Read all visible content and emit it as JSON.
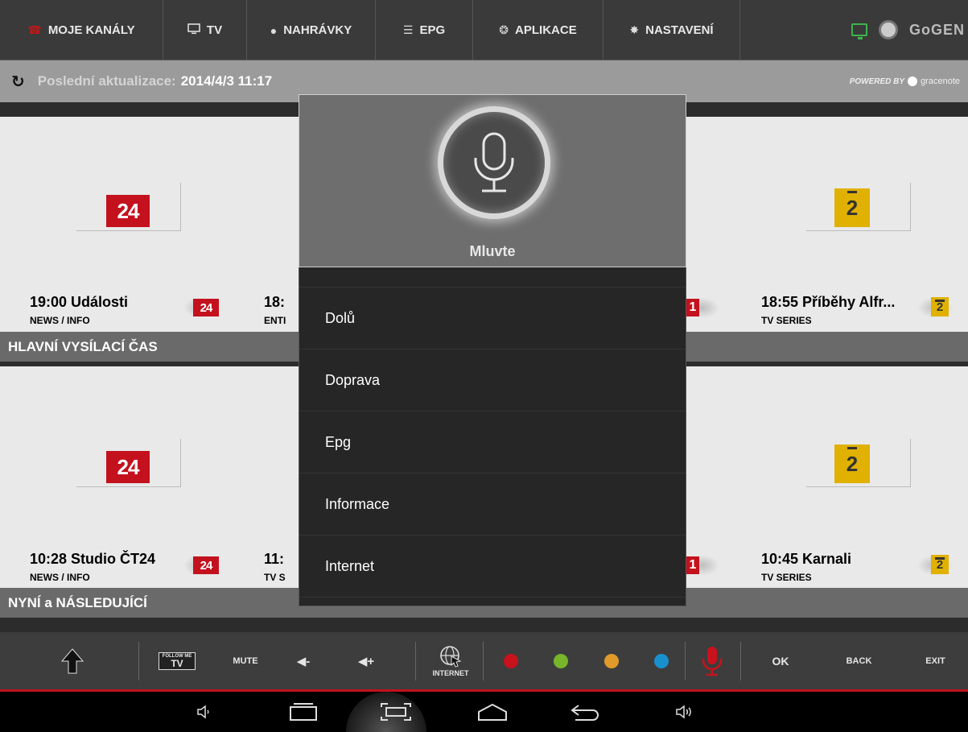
{
  "nav": {
    "items": [
      {
        "label": "MOJE KANÁLY",
        "icon": "remote-icon"
      },
      {
        "label": "TV",
        "icon": "monitor-icon"
      },
      {
        "label": "NAHRÁVKY",
        "icon": "record-dot-icon"
      },
      {
        "label": "EPG",
        "icon": "list-icon"
      },
      {
        "label": "APLIKACE",
        "icon": "apps-icon"
      },
      {
        "label": "NASTAVENÍ",
        "icon": "gear-icon"
      }
    ],
    "brand": "GoGEN"
  },
  "update": {
    "label": "Poslední aktualizace:",
    "value": "2014/4/3 11:17",
    "powered_prefix": "POWERED BY",
    "powered_name": "gracenote"
  },
  "channels": {
    "ct24_logo": "24",
    "nova2_logo": "2",
    "ct1_logo": "1"
  },
  "sections": {
    "prime": "HLAVNÍ VYSÍLACÍ ČAS",
    "now_next": "NYNÍ a NÁSLEDUJÍCÍ"
  },
  "row1": {
    "c1_title": "19:00 Události",
    "c1_genre": "NEWS / INFO",
    "c2_title": "18:",
    "c2_genre": "ENTI",
    "c4_title": "18:55 Příběhy Alfr...",
    "c4_genre": "TV SERIES"
  },
  "row2": {
    "c1_title": "10:28 Studio ČT24",
    "c1_genre": "NEWS / INFO",
    "c2_title": "11:",
    "c2_genre": "TV S",
    "c4_title": "10:45 Karnali",
    "c4_genre": "TV SERIES"
  },
  "voice": {
    "prompt": "Mluvte",
    "options": [
      "Dolů",
      "Doprava",
      "Epg",
      "Informace",
      "Internet"
    ]
  },
  "remote": {
    "follow_top": "FOLLOW ME",
    "follow_bottom": "TV",
    "mute": "MUTE",
    "vol_down": "◀-",
    "vol_up": "◀+",
    "internet": "INTERNET",
    "ok": "OK",
    "back": "BACK",
    "exit": "EXIT",
    "colors": {
      "red": "#c8121c",
      "green": "#77b52a",
      "yellow": "#e09a2a",
      "blue": "#1a8fce"
    }
  }
}
